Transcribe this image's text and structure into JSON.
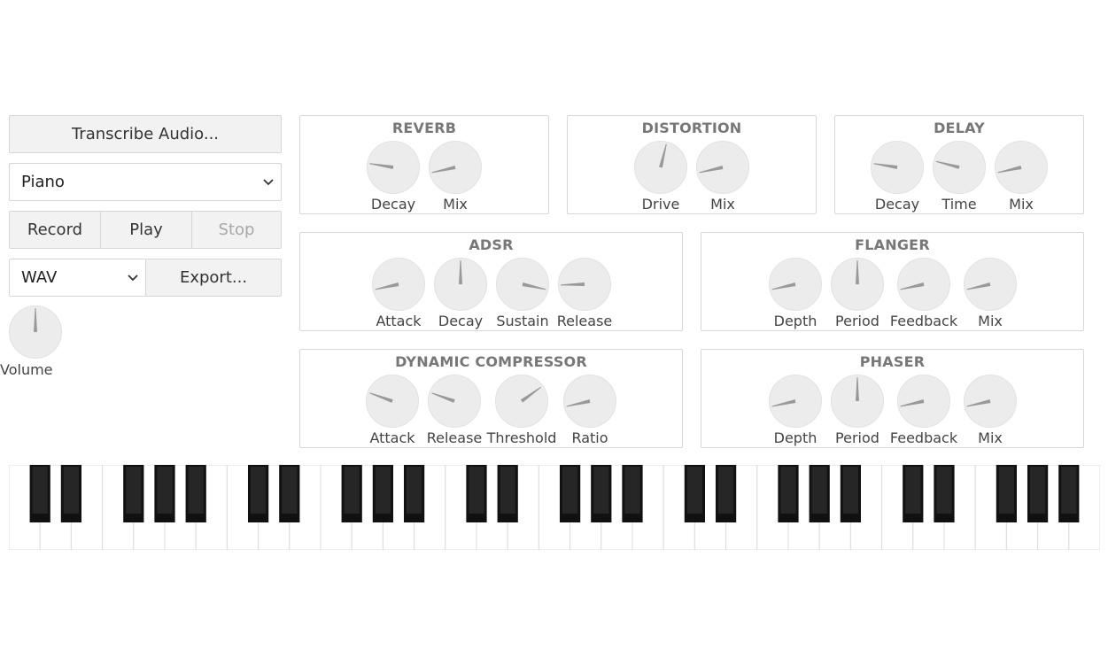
{
  "controls": {
    "transcribe_label": "Transcribe Audio...",
    "instrument_value": "Piano",
    "record_label": "Record",
    "play_label": "Play",
    "stop_label": "Stop",
    "format_value": "WAV",
    "export_label": "Export...",
    "volume_label": "Volume",
    "volume_value": 0.5
  },
  "panels": {
    "reverb": {
      "title": "REVERB",
      "knobs": [
        {
          "label": "Decay",
          "value": 0.2
        },
        {
          "label": "Mix",
          "value": 0.12
        }
      ]
    },
    "distortion": {
      "title": "DISTORTION",
      "knobs": [
        {
          "label": "Drive",
          "value": 0.55
        },
        {
          "label": "Mix",
          "value": 0.12
        }
      ]
    },
    "delay": {
      "title": "DELAY",
      "knobs": [
        {
          "label": "Decay",
          "value": 0.2
        },
        {
          "label": "Time",
          "value": 0.22
        },
        {
          "label": "Mix",
          "value": 0.12
        }
      ]
    },
    "adsr": {
      "title": "ADSR",
      "knobs": [
        {
          "label": "Attack",
          "value": 0.12
        },
        {
          "label": "Decay",
          "value": 0.5
        },
        {
          "label": "Sustain",
          "value": 0.88
        },
        {
          "label": "Release",
          "value": 0.16
        }
      ]
    },
    "flanger": {
      "title": "FLANGER",
      "knobs": [
        {
          "label": "Depth",
          "value": 0.12
        },
        {
          "label": "Period",
          "value": 0.5
        },
        {
          "label": "Feedback",
          "value": 0.12
        },
        {
          "label": "Mix",
          "value": 0.12
        }
      ]
    },
    "compressor": {
      "title": "DYNAMIC COMPRESSOR",
      "knobs": [
        {
          "label": "Attack",
          "value": 0.24
        },
        {
          "label": "Release",
          "value": 0.24
        },
        {
          "label": "Threshold",
          "value": 0.7
        },
        {
          "label": "Ratio",
          "value": 0.12
        }
      ]
    },
    "phaser": {
      "title": "PHASER",
      "knobs": [
        {
          "label": "Depth",
          "value": 0.12
        },
        {
          "label": "Period",
          "value": 0.5
        },
        {
          "label": "Feedback",
          "value": 0.12
        },
        {
          "label": "Mix",
          "value": 0.12
        }
      ]
    }
  },
  "keyboard": {
    "white_key_count": 35,
    "white_key_color": "#ffffff",
    "black_key_color": "#111111"
  },
  "colors": {
    "knob_face": "#ececec",
    "knob_indicator": "#999999"
  }
}
